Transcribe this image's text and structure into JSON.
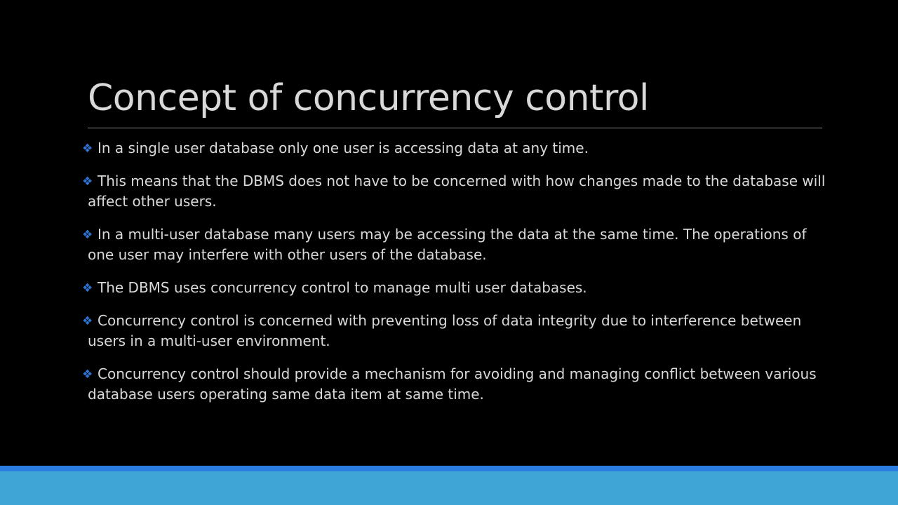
{
  "slide": {
    "title": "Concept of concurrency control",
    "bullet_icon": "diamond-bullet-icon",
    "bullet_glyph": "❖",
    "bullets": [
      "In a single user database only one user is accessing data at any time.",
      "This means that the DBMS does not have to be concerned with how changes made to the database will affect other users.",
      "In a multi-user database many users may be accessing the data at the same time. The operations of one user may interfere with other users of the database.",
      "The DBMS uses concurrency control to manage multi user databases.",
      "Concurrency control is concerned with preventing loss of data integrity due to interference between users in a multi-user environment.",
      "Concurrency control should provide a mechanism for avoiding and managing conflict between various database users operating same data item at same time."
    ]
  },
  "colors": {
    "background": "#000000",
    "text": "#d9d9d9",
    "bullet_accent": "#2e74d4",
    "footer_dark": "#2a7de1",
    "footer_light": "#3fa5d6"
  }
}
